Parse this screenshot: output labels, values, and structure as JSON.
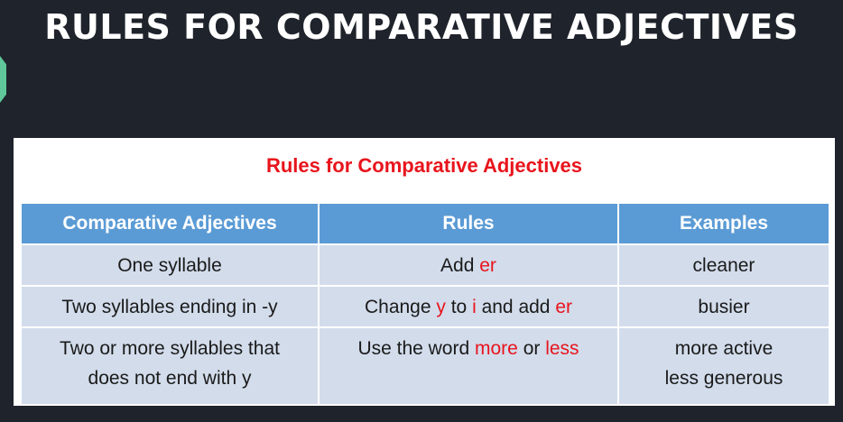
{
  "heading": "RULES FOR COMPARATIVE ADJECTIVES",
  "slide_title": "Rules for Comparative Adjectives",
  "colors": {
    "background": "#1f232b",
    "header": "#5b9bd5",
    "row": "#d2dceb",
    "highlight": "#e8141c",
    "tab": "#5fc79a"
  },
  "table": {
    "headers": [
      "Comparative Adjectives",
      "Rules",
      "Examples"
    ],
    "rows": [
      {
        "adjective": "One syllable",
        "rule": {
          "t1": "Add ",
          "r1": "er"
        },
        "examples": [
          "cleaner"
        ]
      },
      {
        "adjective": "Two syllables ending in -y",
        "rule": {
          "t1": "Change ",
          "r1": "y",
          "t2": " to ",
          "r2": "i",
          "t3": " and add ",
          "r3": "er"
        },
        "examples": [
          "busier"
        ]
      },
      {
        "adjective_lines": [
          "Two or more syllables that",
          "does not end with y"
        ],
        "rule": {
          "t1": "Use the word ",
          "r1": "more",
          "t2": " or ",
          "r2": "less"
        },
        "examples": [
          "more active",
          "less generous"
        ]
      }
    ]
  }
}
